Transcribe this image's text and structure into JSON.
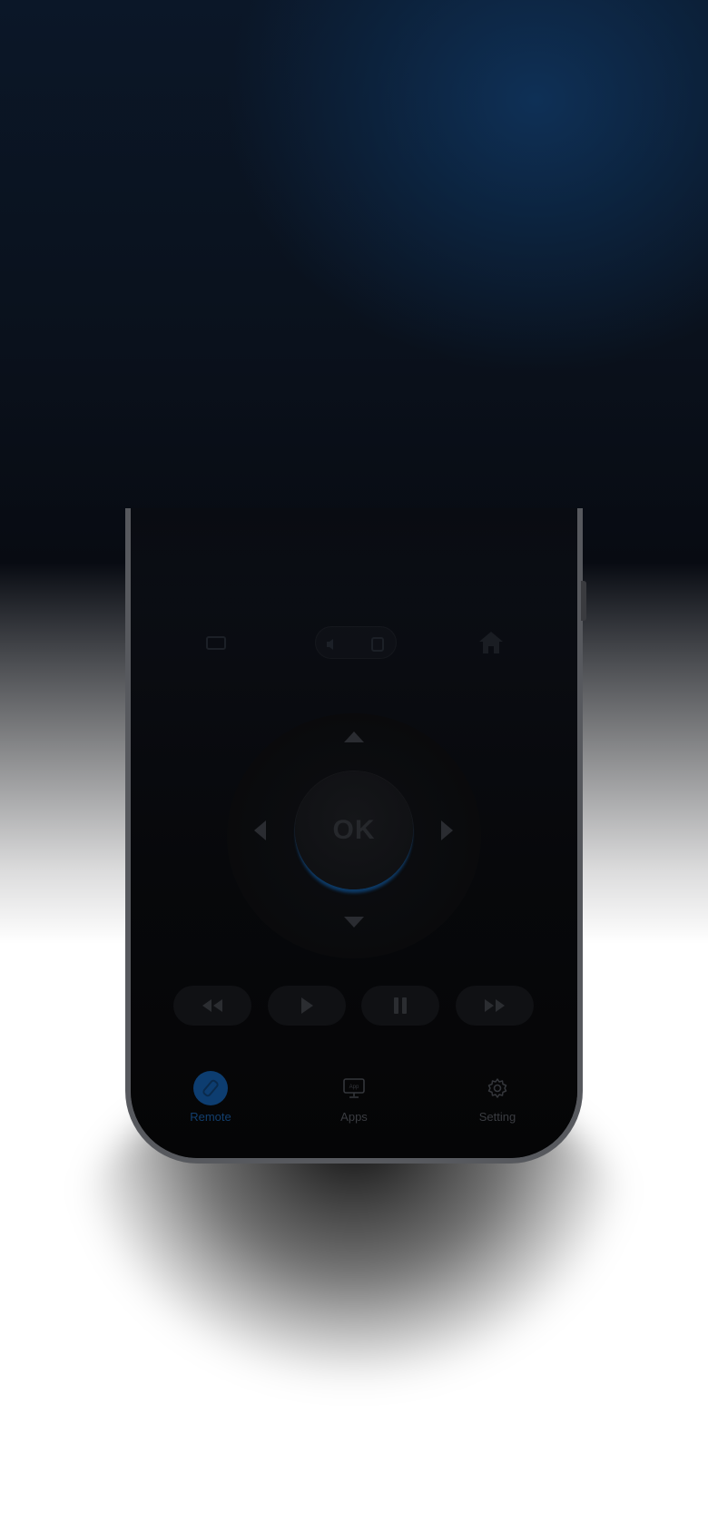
{
  "dpad": {
    "ok_label": "OK"
  },
  "media": {
    "rewind_icon": "rewind-icon",
    "play_icon": "play-icon",
    "pause_icon": "pause-icon",
    "fast_forward_icon": "fast-forward-icon"
  },
  "tabs": [
    {
      "label": "Remote",
      "icon": "remote-icon",
      "active": true
    },
    {
      "label": "Apps",
      "icon": "apps-icon",
      "active": false
    },
    {
      "label": "Setting",
      "icon": "gear-icon",
      "active": false
    }
  ],
  "colors": {
    "accent": "#0d3d70",
    "background": "#0b1728"
  }
}
